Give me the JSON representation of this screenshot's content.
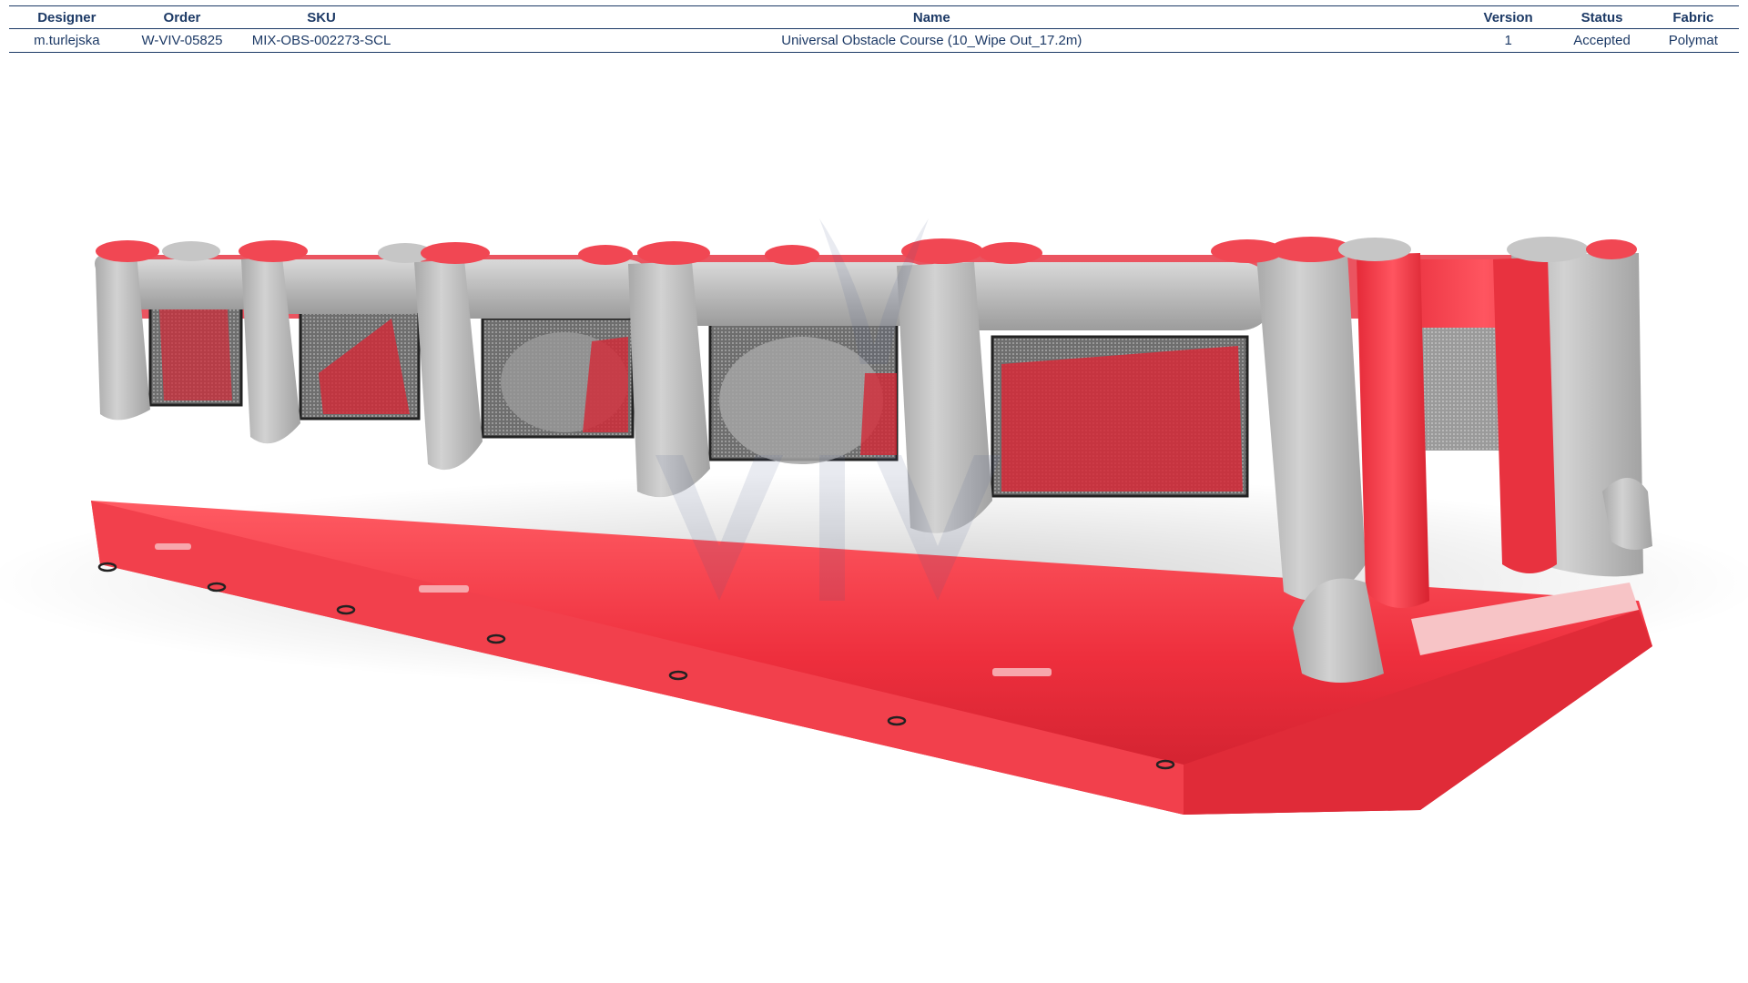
{
  "spec_table": {
    "headers": {
      "designer": "Designer",
      "order": "Order",
      "sku": "SKU",
      "name": "Name",
      "version": "Version",
      "status": "Status",
      "fabric": "Fabric"
    },
    "row": {
      "designer": "m.turlejska",
      "order": "W-VIV-05825",
      "sku": "MIX-OBS-002273-SCL",
      "name": "Universal Obstacle Course (10_Wipe Out_17.2m)",
      "version": "1",
      "status": "Accepted",
      "fabric": "Polymat"
    }
  },
  "colors": {
    "table_text": "#1d3a66",
    "inflatable_red": "#ee3a47",
    "inflatable_grey": "#b9b9b9",
    "mesh": "#8a8a8a"
  },
  "render": {
    "subject": "inflatable obstacle course render",
    "watermark_logo": "VIV"
  }
}
